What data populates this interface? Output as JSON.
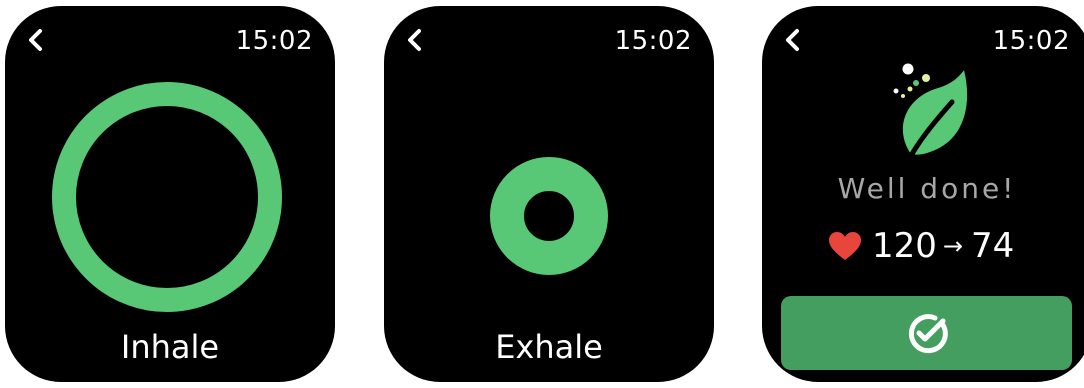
{
  "colors": {
    "accent": "#58C776",
    "button": "#449E60",
    "heart": "#E8453C",
    "muted_text": "#A7A7A7",
    "background": "#000000"
  },
  "screens": [
    {
      "id": "inhale",
      "back_icon": "chevron-left-icon",
      "time": "15:02",
      "phase": "Inhale"
    },
    {
      "id": "exhale",
      "back_icon": "chevron-left-icon",
      "time": "15:02",
      "phase": "Exhale"
    },
    {
      "id": "summary",
      "back_icon": "chevron-left-icon",
      "time": "15:02",
      "icon": "leaf-icon",
      "message": "Well done!",
      "heart_rate": {
        "icon": "heart-icon",
        "before": "120",
        "arrow": "→",
        "after": "74"
      },
      "done_button_icon": "check-circle-icon"
    }
  ]
}
